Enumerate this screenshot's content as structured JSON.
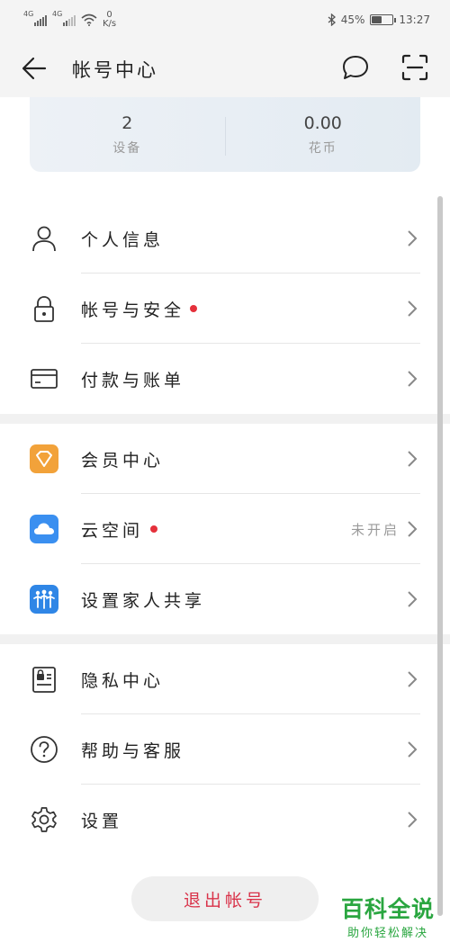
{
  "status_bar": {
    "net1": "4G",
    "net2": "4G",
    "speed_value": "0",
    "speed_unit": "K/s",
    "battery_percent": "45%",
    "battery_level": 0.45,
    "time": "13:27"
  },
  "header": {
    "title": "帐号中心",
    "back_icon": "arrow-left-icon",
    "message_icon": "chat-bubble-icon",
    "scan_icon": "scan-icon"
  },
  "stats": {
    "devices_value": "2",
    "devices_label": "设备",
    "coins_value": "0.00",
    "coins_label": "花币"
  },
  "groups": [
    [
      {
        "label": "个人信息",
        "icon": "person-icon"
      },
      {
        "label": "帐号与安全",
        "icon": "lock-icon",
        "dot": true
      },
      {
        "label": "付款与账单",
        "icon": "card-icon"
      }
    ],
    [
      {
        "label": "会员中心",
        "icon": "vip-diamond-icon"
      },
      {
        "label": "云空间",
        "icon": "cloud-icon",
        "dot": true,
        "meta": "未开启"
      },
      {
        "label": "设置家人共享",
        "icon": "family-icon"
      }
    ],
    [
      {
        "label": "隐私中心",
        "icon": "privacy-icon"
      },
      {
        "label": "帮助与客服",
        "icon": "help-icon"
      },
      {
        "label": "设置",
        "icon": "gear-icon"
      }
    ]
  ],
  "logout_label": "退出帐号",
  "watermark": {
    "title": "百科全说",
    "subtitle": "助你轻松解决"
  },
  "colors": {
    "accent_red": "#e5303b",
    "logout_text": "#d9334a",
    "watermark_green": "#2aa640"
  }
}
